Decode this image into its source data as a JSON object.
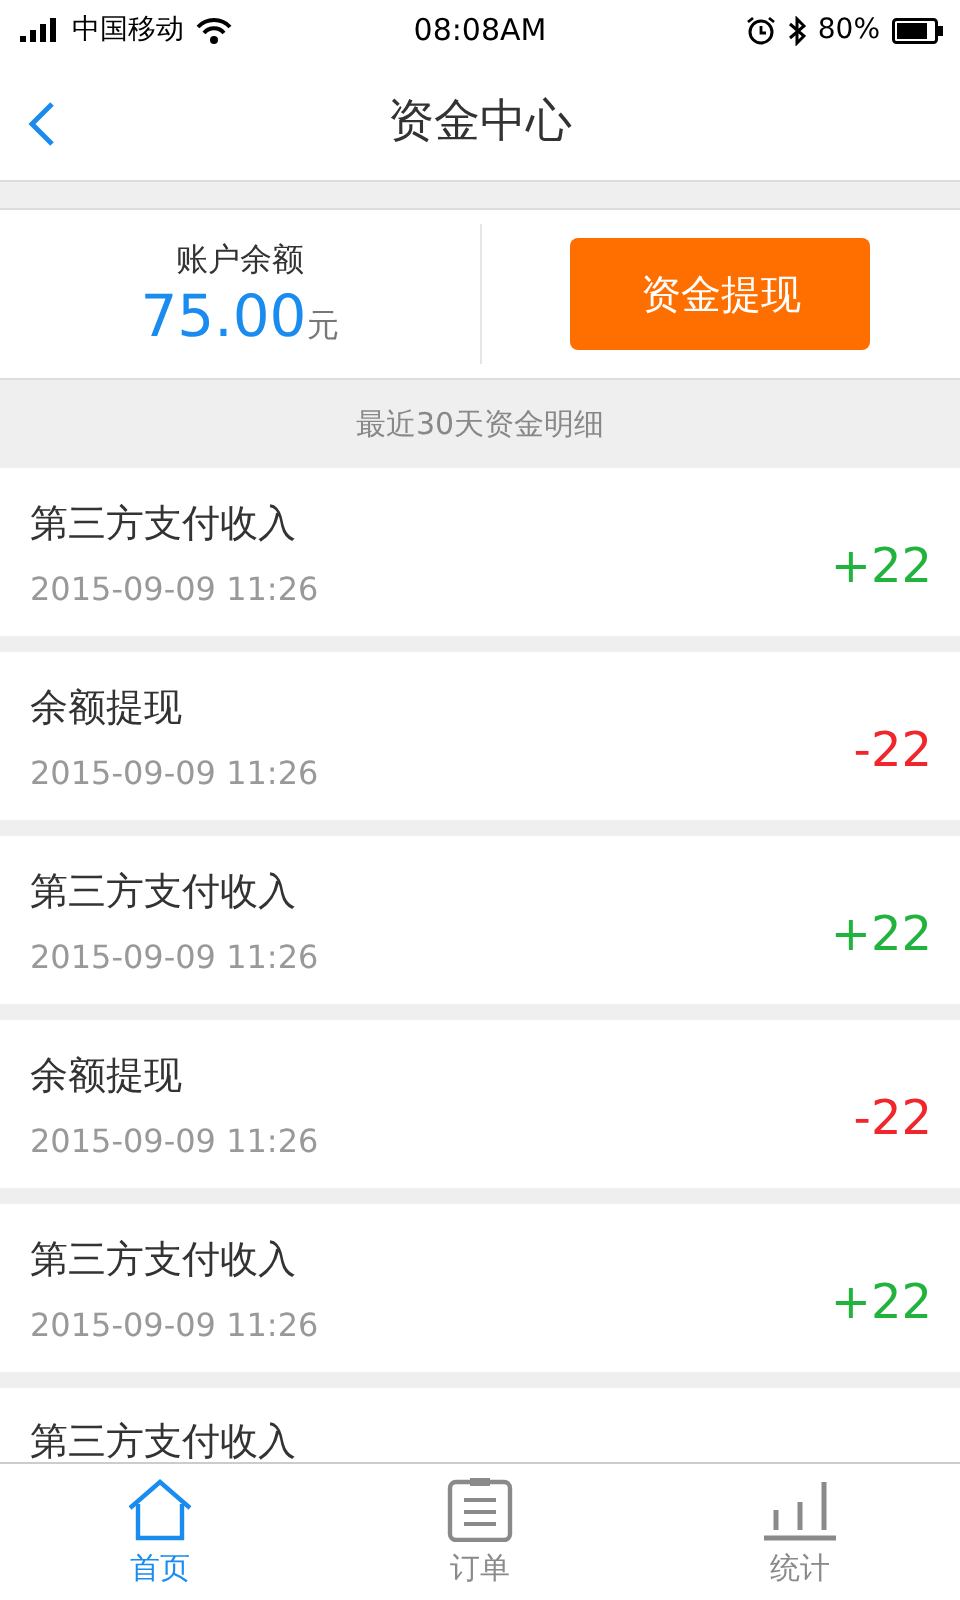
{
  "status_bar": {
    "carrier": "中国移动",
    "time": "08:08AM",
    "battery": "80%"
  },
  "nav": {
    "title": "资金中心"
  },
  "balance": {
    "label": "账户余额",
    "amount": "75.00",
    "unit": "元",
    "button": "资金提现"
  },
  "section_header": "最近30天资金明细",
  "transactions": [
    {
      "title": "第三方支付收入",
      "date": "2015-09-09 11:26",
      "amount": "+22",
      "kind": "income"
    },
    {
      "title": "余额提现",
      "date": "2015-09-09 11:26",
      "amount": "-22",
      "kind": "withdrawal"
    },
    {
      "title": "第三方支付收入",
      "date": "2015-09-09 11:26",
      "amount": "+22",
      "kind": "income"
    },
    {
      "title": "余额提现",
      "date": "2015-09-09 11:26",
      "amount": "-22",
      "kind": "withdrawal"
    },
    {
      "title": "第三方支付收入",
      "date": "2015-09-09 11:26",
      "amount": "+22",
      "kind": "income"
    },
    {
      "title": "第三方支付收入"
    }
  ],
  "tab_bar": [
    {
      "label": "首页",
      "kind": "home",
      "selected": true
    },
    {
      "label": "订单",
      "kind": "orders",
      "selected": false
    },
    {
      "label": "统计",
      "kind": "stats",
      "selected": false
    }
  ]
}
